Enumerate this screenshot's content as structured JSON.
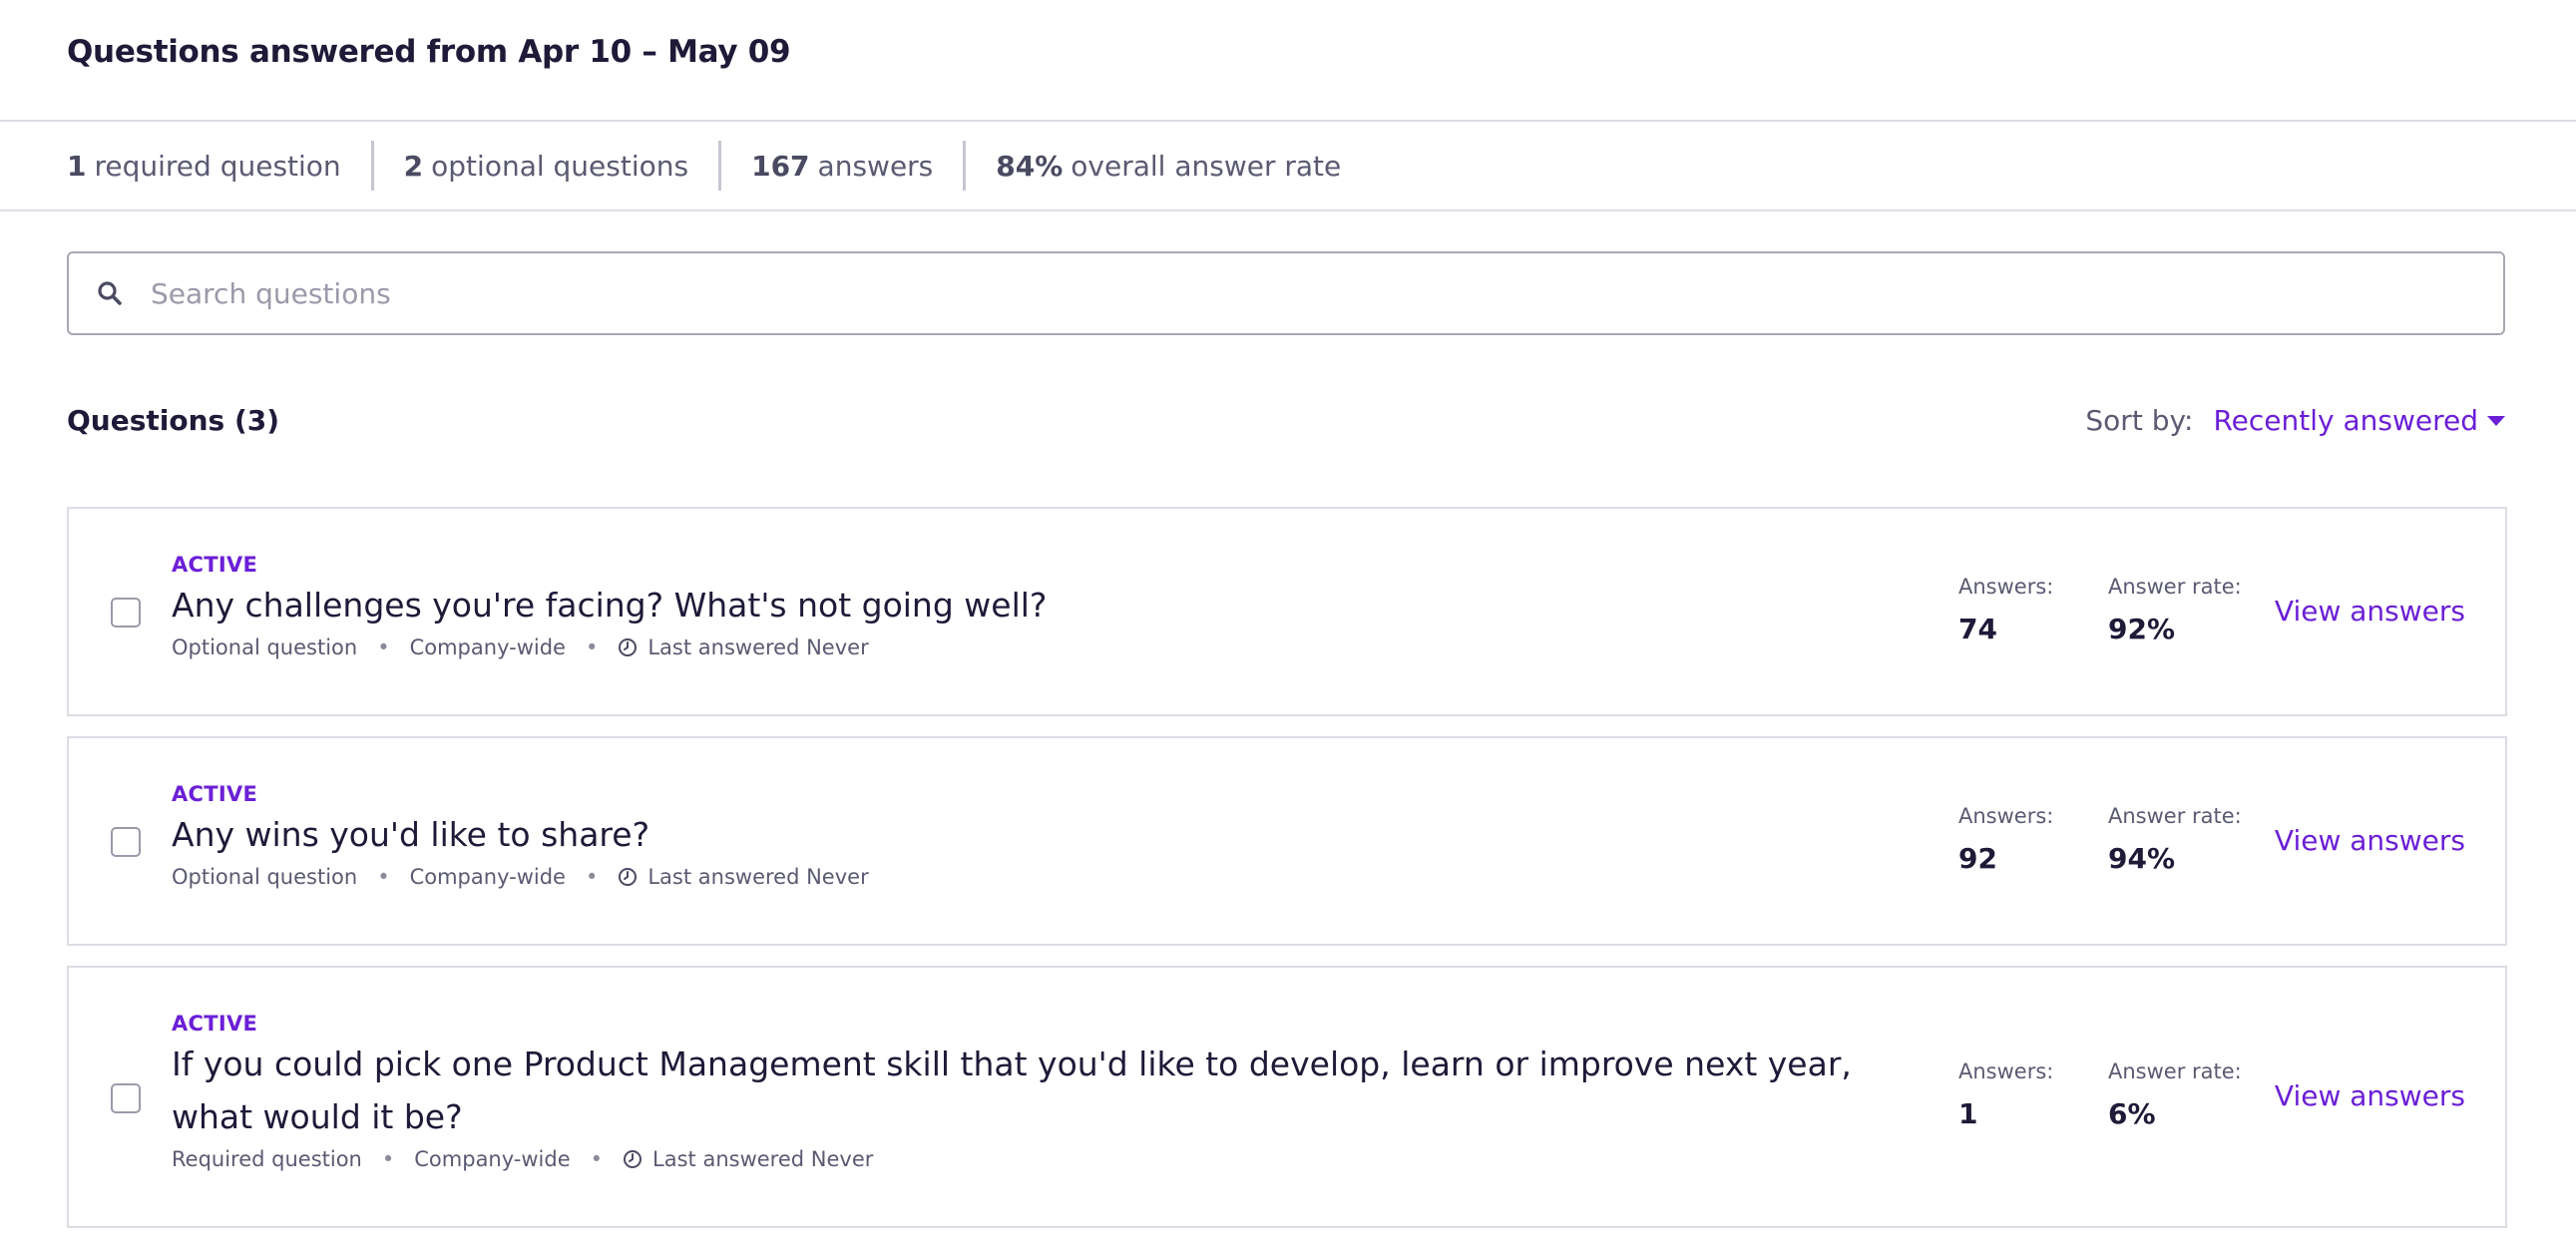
{
  "header": {
    "title": "Questions answered from Apr 10 – May 09"
  },
  "stats": [
    {
      "value": "1",
      "label": "required question"
    },
    {
      "value": "2",
      "label": "optional questions"
    },
    {
      "value": "167",
      "label": "answers"
    },
    {
      "value": "84%",
      "label": "overall answer rate"
    }
  ],
  "search": {
    "placeholder": "Search questions",
    "icon": "search-icon"
  },
  "list": {
    "title": "Questions (3)"
  },
  "sort": {
    "label": "Sort by:",
    "value": "Recently answered"
  },
  "questions": [
    {
      "status": "ACTIVE",
      "text": "Any challenges you're facing? What's not going well?",
      "type": "Optional question",
      "scope": "Company-wide",
      "last_answered": "Last answered Never",
      "answers_label": "Answers:",
      "answers": "74",
      "rate_label": "Answer rate:",
      "rate": "92%",
      "action": "View answers"
    },
    {
      "status": "ACTIVE",
      "text": "Any wins you'd like to share?",
      "type": "Optional question",
      "scope": "Company-wide",
      "last_answered": "Last answered Never",
      "answers_label": "Answers:",
      "answers": "92",
      "rate_label": "Answer rate:",
      "rate": "94%",
      "action": "View answers"
    },
    {
      "status": "ACTIVE",
      "text": "If you could pick one Product Management skill that you'd like to develop, learn or improve next year, what would it be?",
      "type": "Required question",
      "scope": "Company-wide",
      "last_answered": "Last answered Never",
      "answers_label": "Answers:",
      "answers": "1",
      "rate_label": "Answer rate:",
      "rate": "6%",
      "action": "View answers"
    }
  ],
  "colors": {
    "accent": "#6b1fd6",
    "text": "#1e1a38",
    "muted": "#5a5a72",
    "border": "#dcdce4"
  }
}
